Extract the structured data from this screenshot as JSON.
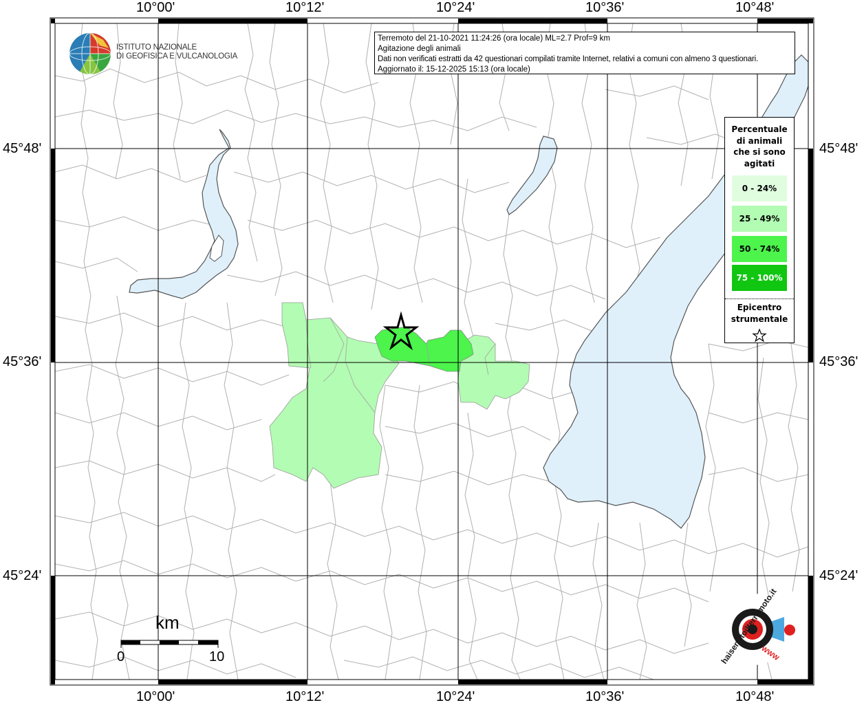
{
  "axes": {
    "lon_labels": [
      "10°00'",
      "10°12'",
      "10°24'",
      "10°36'",
      "10°48'"
    ],
    "lat_labels": [
      "45°48'",
      "45°36'",
      "45°24'"
    ]
  },
  "info": {
    "line1": "Terremoto del 21-10-2021 11:24:26 (ora locale) ML=2.7 Prof=9 km",
    "line2": "Agitazione degli animali",
    "line3": "Dati non verificati estratti da 42 questionari compilati tramite Internet, relativi a comuni con almeno 3 questionari.",
    "line4": "Aggiornato il: 15-12-2025 15:13 (ora locale)"
  },
  "logo": {
    "line1": "ISTITUTO NAZIONALE",
    "line2": "DI GEOFISICA E VULCANOLOGIA"
  },
  "legend": {
    "title_lines": [
      "Percentuale",
      "di animali",
      "che si sono",
      "agitati"
    ],
    "classes": [
      {
        "label": "0 - 24%",
        "color": "#e0fde0"
      },
      {
        "label": "25 - 49%",
        "color": "#b3fcb3"
      },
      {
        "label": "50 - 74%",
        "color": "#4cf44c"
      },
      {
        "label": "75 - 100%",
        "color": "#11c611"
      }
    ],
    "epicenter_lines": [
      "Epicentro",
      "strumentale"
    ]
  },
  "scale": {
    "unit": "km",
    "start": "0",
    "end": "10"
  },
  "badge": {
    "text_main": "haisentitoilterremoto.it",
    "text_www": "WWW"
  },
  "colors": {
    "lake": "#dff0fb",
    "lake_stroke": "#555555",
    "pct_25_49": "#b3fcb3",
    "pct_50_74": "#4cf44c",
    "border": "#b0b0b0",
    "grid": "#000000"
  }
}
